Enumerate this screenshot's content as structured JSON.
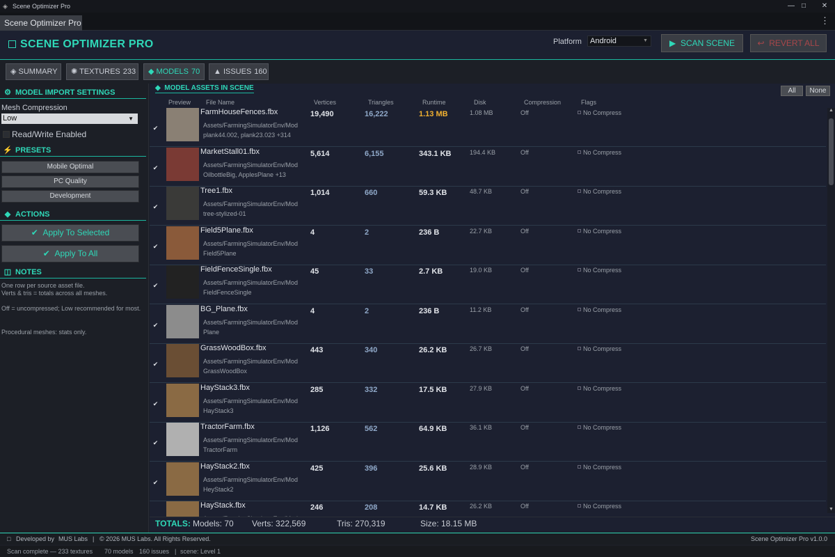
{
  "window": {
    "title": "Scene Optimizer Pro",
    "minimize_glyph": "—",
    "maximize_glyph": "□",
    "close_glyph": "✕"
  },
  "tabbar": {
    "tab_label": "Scene Optimizer Pro",
    "menu_glyph": "⋮"
  },
  "header": {
    "title": "SCENE OPTIMIZER PRO",
    "platform_label": "Platform",
    "platform_value": "Android",
    "scan_label": "SCAN SCENE",
    "scan_glyph": "▶",
    "revert_label": "REVERT ALL",
    "revert_glyph": "↩",
    "accent_color": "#2fd8b8",
    "danger_color": "#a8474a"
  },
  "nav": [
    {
      "label": "SUMMARY",
      "glyph": "◈",
      "count": ""
    },
    {
      "label": "TEXTURES",
      "glyph": "✺",
      "count": "233"
    },
    {
      "label": "MODELS",
      "glyph": "◆",
      "count": "70"
    },
    {
      "label": "ISSUES",
      "glyph": "▲",
      "count": "160"
    }
  ],
  "sidebar": {
    "import_head": "MODEL IMPORT SETTINGS",
    "import_glyph": "⚙",
    "mesh_compression_label": "Mesh Compression",
    "mesh_compression_value": "Low",
    "rw_label": "Read/Write Enabled",
    "presets_head": "PRESETS",
    "presets_glyph": "⚡",
    "presets": [
      "Mobile Optimal",
      "PC Quality",
      "Development"
    ],
    "actions_head": "ACTIONS",
    "actions_glyph": "◆",
    "apply_selected": "Apply To Selected",
    "apply_all": "Apply To All",
    "check_glyph": "✔",
    "notes_head": "NOTES",
    "notes_glyph": "◫",
    "notes": [
      "One row per source asset file.",
      "Verts & tris = totals across all meshes.",
      "Off = uncompressed; Low recommended for most.",
      "Procedural meshes: stats only."
    ]
  },
  "main": {
    "heading": "MODEL ASSETS IN SCENE",
    "heading_glyph": "◆",
    "all_label": "All",
    "none_label": "None",
    "columns": [
      "Preview",
      "File Name",
      "Vertices",
      "Triangles",
      "Runtime",
      "Disk",
      "Compression",
      "Flags"
    ],
    "rows": [
      {
        "name": "FarmHouseFences.fbx",
        "path1": "Assets/FarmingSimulatorEnv/Mod",
        "path2": "plank44.002, plank23.023 +314",
        "verts": "19,490",
        "tris": "16,222",
        "runtime": "1.13 MB",
        "runtime_warn": true,
        "disk": "1.08 MB",
        "comp": "Off",
        "flags": "No Compress",
        "thumb_color": "#8a8074",
        "checked": true
      },
      {
        "name": "MarketStall01.fbx",
        "path1": "Assets/FarmingSimulatorEnv/Mod",
        "path2": "OilbottleBig, ApplesPlane +13",
        "verts": "5,614",
        "tris": "6,155",
        "runtime": "343.1 KB",
        "runtime_warn": false,
        "disk": "194.4 KB",
        "comp": "Off",
        "flags": "No Compress",
        "thumb_color": "#7a3a34",
        "checked": true
      },
      {
        "name": "Tree1.fbx",
        "path1": "Assets/FarmingSimulatorEnv/Mod",
        "path2": "tree-stylized-01",
        "verts": "1,014",
        "tris": "660",
        "runtime": "59.3 KB",
        "runtime_warn": false,
        "disk": "48.7 KB",
        "comp": "Off",
        "flags": "No Compress",
        "thumb_color": "#3a3a38",
        "checked": true
      },
      {
        "name": "Field5Plane.fbx",
        "path1": "Assets/FarmingSimulatorEnv/Mod",
        "path2": "Field5Plane",
        "verts": "4",
        "tris": "2",
        "runtime": "236 B",
        "runtime_warn": false,
        "disk": "22.7 KB",
        "comp": "Off",
        "flags": "No Compress",
        "thumb_color": "#8a5a3a",
        "checked": true
      },
      {
        "name": "FieldFenceSingle.fbx",
        "path1": "Assets/FarmingSimulatorEnv/Mod",
        "path2": "FieldFenceSingle",
        "verts": "45",
        "tris": "33",
        "runtime": "2.7 KB",
        "runtime_warn": false,
        "disk": "19.0 KB",
        "comp": "Off",
        "flags": "No Compress",
        "thumb_color": "#222222",
        "checked": true
      },
      {
        "name": "BG_Plane.fbx",
        "path1": "Assets/FarmingSimulatorEnv/Mod",
        "path2": "Plane",
        "verts": "4",
        "tris": "2",
        "runtime": "236 B",
        "runtime_warn": false,
        "disk": "11.2 KB",
        "comp": "Off",
        "flags": "No Compress",
        "thumb_color": "#8c8c8c",
        "checked": true
      },
      {
        "name": "GrassWoodBox.fbx",
        "path1": "Assets/FarmingSimulatorEnv/Mod",
        "path2": "GrassWoodBox",
        "verts": "443",
        "tris": "340",
        "runtime": "26.2 KB",
        "runtime_warn": false,
        "disk": "26.7 KB",
        "comp": "Off",
        "flags": "No Compress",
        "thumb_color": "#6a4e34",
        "checked": true
      },
      {
        "name": "HayStack3.fbx",
        "path1": "Assets/FarmingSimulatorEnv/Mod",
        "path2": "HayStack3",
        "verts": "285",
        "tris": "332",
        "runtime": "17.5 KB",
        "runtime_warn": false,
        "disk": "27.9 KB",
        "comp": "Off",
        "flags": "No Compress",
        "thumb_color": "#8a6a44",
        "checked": true
      },
      {
        "name": "TractorFarm.fbx",
        "path1": "Assets/FarmingSimulatorEnv/Mod",
        "path2": "TractorFarm",
        "verts": "1,126",
        "tris": "562",
        "runtime": "64.9 KB",
        "runtime_warn": false,
        "disk": "36.1 KB",
        "comp": "Off",
        "flags": "No Compress",
        "thumb_color": "#b0b0b0",
        "checked": true
      },
      {
        "name": "HayStack2.fbx",
        "path1": "Assets/FarmingSimulatorEnv/Mod",
        "path2": "HeyStack2",
        "verts": "425",
        "tris": "396",
        "runtime": "25.6 KB",
        "runtime_warn": false,
        "disk": "28.9 KB",
        "comp": "Off",
        "flags": "No Compress",
        "thumb_color": "#8a6a44",
        "checked": true
      },
      {
        "name": "HayStack.fbx",
        "path1": "Assets/FarmingSimulatorEnv/Mod",
        "path2": "",
        "verts": "246",
        "tris": "208",
        "runtime": "14.7 KB",
        "runtime_warn": false,
        "disk": "26.2 KB",
        "comp": "Off",
        "flags": "No Compress",
        "thumb_color": "#8a6a44",
        "checked": false
      }
    ]
  },
  "totals": {
    "label": "TOTALS:",
    "models": "Models: 70",
    "verts": "Verts: 322,569",
    "tris": "Tris: 270,319",
    "size": "Size: 18.15 MB"
  },
  "footer": {
    "developed_by": "Developed by",
    "company": "MUS Labs",
    "copyright": "© 2026 MUS Labs. All Rights Reserved.",
    "version": "Scene Optimizer Pro  v1.0.0"
  },
  "status": {
    "text1": "Scan complete — 233 textures",
    "text2": "70 models",
    "text3": "160 issues",
    "text4": "scene: Level 1"
  }
}
